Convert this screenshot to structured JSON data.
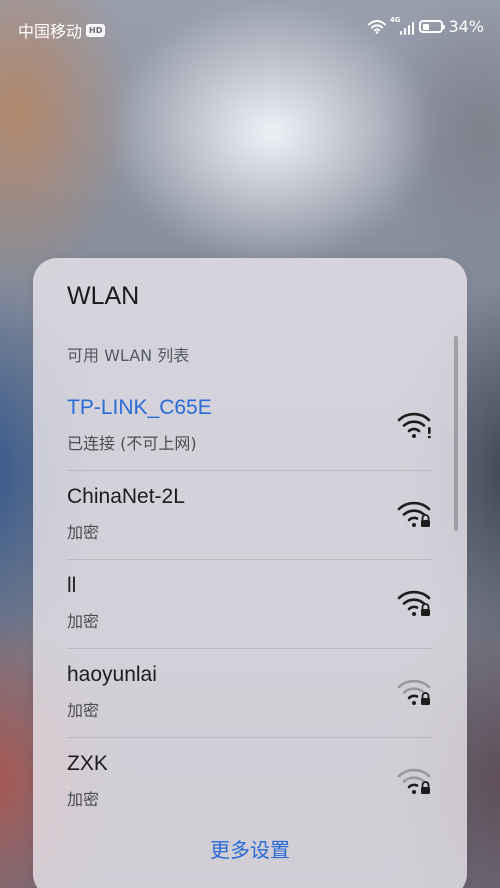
{
  "status_bar": {
    "carrier": "中国移动",
    "hd_badge": "HD",
    "network_type": "4G",
    "battery_percent": "34%",
    "battery_level": 0.34
  },
  "panel": {
    "title": "WLAN",
    "section_label": "可用 WLAN 列表",
    "networks": [
      {
        "name": "TP-LINK_C65E",
        "status": "已连接 (不可上网)",
        "connected": true,
        "icon": "wifi-alert-icon"
      },
      {
        "name": "ChinaNet-2L",
        "status": "加密",
        "connected": false,
        "icon": "wifi-lock-icon"
      },
      {
        "name": "ll",
        "status": "加密",
        "connected": false,
        "icon": "wifi-lock-icon"
      },
      {
        "name": "haoyunlai",
        "status": "加密",
        "connected": false,
        "icon": "wifi-weak-lock-icon"
      },
      {
        "name": "ZXK",
        "status": "加密",
        "connected": false,
        "icon": "wifi-weak-lock-icon"
      }
    ],
    "more_settings_label": "更多设置"
  },
  "colors": {
    "accent": "#2a6bd6",
    "text_primary": "#1c1c1c",
    "text_secondary": "#4a4d52"
  }
}
